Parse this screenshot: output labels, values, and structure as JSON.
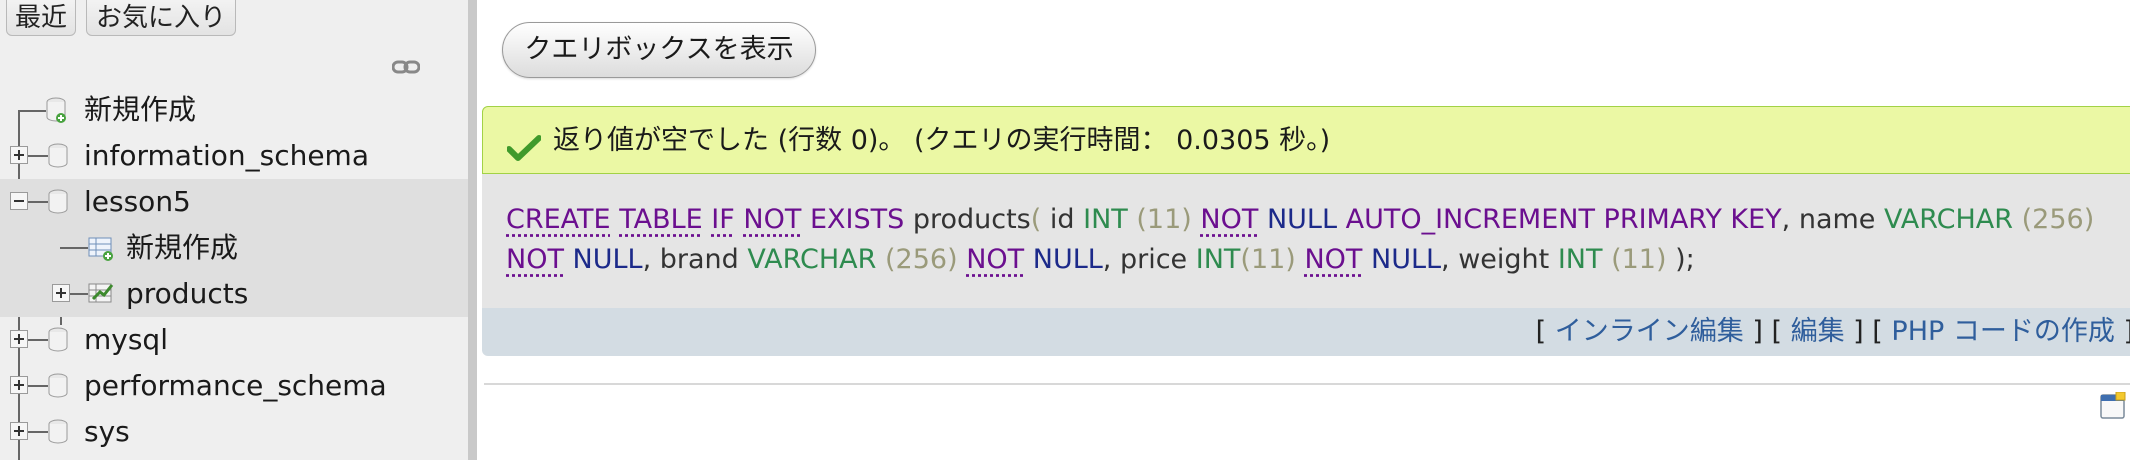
{
  "sidebar": {
    "tabs": {
      "recent": "最近",
      "favorites": "お気に入り"
    },
    "tree": {
      "new_top": "新規作成",
      "db_information_schema": "information_schema",
      "db_lesson5": "lesson5",
      "lesson5_new": "新規作成",
      "lesson5_products": "products",
      "db_mysql": "mysql",
      "db_performance_schema": "performance_schema",
      "db_sys": "sys"
    }
  },
  "main": {
    "show_query_button": "クエリボックスを表示",
    "success_message": "返り値が空でした (行数 0)。 (クエリの実行時間： 0.0305 秒。)",
    "sql": {
      "t1": "CREATE",
      "t2": "TABLE",
      "t3": "IF",
      "t4": "NOT",
      "t5": "EXISTS",
      "t6": "products",
      "t7": "(",
      "t8": "id",
      "t9": "INT",
      "t10": "(11)",
      "t11": "NOT",
      "t12": "NULL",
      "t13": "AUTO_INCREMENT PRIMARY KEY",
      "t14": ", name",
      "t15": "VARCHAR",
      "t16": "(256)",
      "t17": "NOT",
      "t18": "NULL",
      "t19": ", brand",
      "t20": "VARCHAR",
      "t21": "(256)",
      "t22": "NOT",
      "t23": "NULL",
      "t24": ", price",
      "t25": "INT",
      "t26": "(11)",
      "t27": "NOT",
      "t28": "NULL",
      "t29": ", weight",
      "t30": "INT",
      "t31": "(11)",
      "t32": ");"
    },
    "actions": {
      "open1": "[ ",
      "inline_edit": "インライン編集",
      "close1": " ] [ ",
      "edit": "編集",
      "close2": " ] [ ",
      "php_code": "PHP コードの作成",
      "close3": " ]"
    }
  },
  "colors": {
    "success_bg": "#ebf8a4",
    "keyword": "#6b0f8f",
    "type": "#2e8b4f",
    "null": "#1c2a8a",
    "link": "#2f5e9c"
  },
  "icons": [
    "link-icon",
    "database-icon",
    "new-item-icon",
    "table-icon",
    "check-icon",
    "console-icon"
  ]
}
